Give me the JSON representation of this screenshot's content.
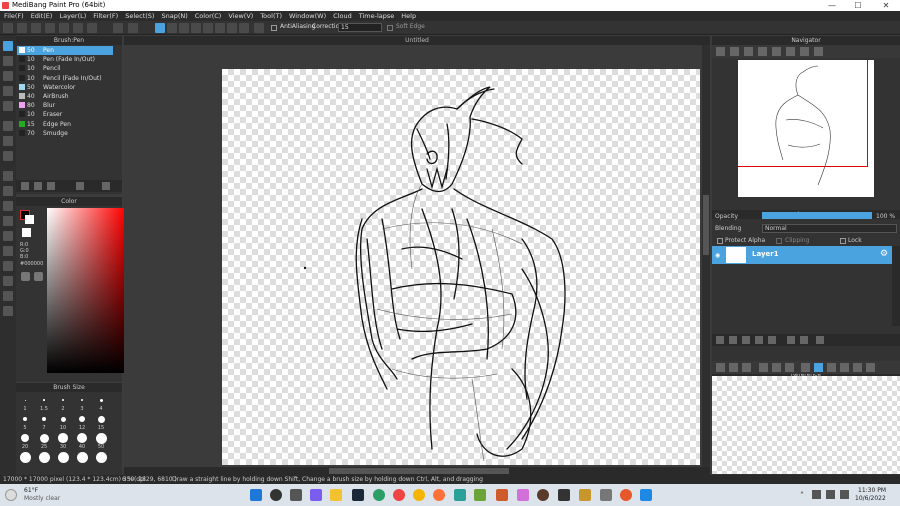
{
  "window": {
    "title": "MediBang Paint Pro (64bit)",
    "min": "—",
    "max": "☐",
    "close": "✕"
  },
  "menu": [
    "File(F)",
    "Edit(E)",
    "Layer(L)",
    "Filter(F)",
    "Select(S)",
    "Snap(N)",
    "Color(C)",
    "View(V)",
    "Tool(T)",
    "Window(W)",
    "Cloud",
    "Time-lapse",
    "Help"
  ],
  "toolbar": {
    "antialiasing": "AntiAliasing",
    "correction_label": "Correction",
    "correction_value": "15",
    "soft_edge": "Soft Edge"
  },
  "brush_panel": {
    "title": "Brush:Pen",
    "items": [
      {
        "size": "50",
        "name": "Pen",
        "color": "#ffffff",
        "selected": true
      },
      {
        "size": "10",
        "name": "Pen (Fade In/Out)",
        "color": "#222222"
      },
      {
        "size": "10",
        "name": "Pencil",
        "color": "#222222"
      },
      {
        "size": "10",
        "name": "Pencil (Fade In/Out)",
        "color": "#222222"
      },
      {
        "size": "50",
        "name": "Watercolor",
        "color": "#9fd8f0"
      },
      {
        "size": "40",
        "name": "AirBrush",
        "color": "#bbbbbb"
      },
      {
        "size": "80",
        "name": "Blur",
        "color": "#f0a0f0"
      },
      {
        "size": "10",
        "name": "Eraser",
        "color": "#222222"
      },
      {
        "size": "15",
        "name": "Edge Pen",
        "color": "#22aa22"
      },
      {
        "size": "70",
        "name": "Smudge",
        "color": "#222222"
      }
    ]
  },
  "color_panel": {
    "title": "Color",
    "r": "R:0",
    "g": "G:0",
    "b": "B:0",
    "hex": "#000000"
  },
  "brush_size_panel": {
    "title": "Brush Size",
    "labels": [
      "1",
      "1.5",
      "2",
      "3",
      "4",
      "5",
      "7",
      "10",
      "12",
      "15",
      "20",
      "25",
      "30",
      "40",
      "50"
    ]
  },
  "document": {
    "tab": "Untitled"
  },
  "status": {
    "size": "17000 * 17000 pixel  (123.4 * 123.4cm)  350 dpi",
    "zoom": "6 %",
    "coords": "( 2829, 6810 )",
    "hint": "Draw a straight line by holding down Shift, Change a brush size by holding down Ctrl, Alt, and dragging"
  },
  "navigator": {
    "title": "Navigator"
  },
  "layer_panel": {
    "title": "Layer",
    "opacity_label": "Opacity",
    "opacity_value": "100 %",
    "opacity": 1.0,
    "blending_label": "Blending",
    "blending_value": "Normal",
    "protect_alpha": "Protect Alpha",
    "clipping": "Clipping",
    "lock": "Lock",
    "layer_name": "Layer1"
  },
  "reference": {
    "title": "Reference"
  },
  "taskbar": {
    "temp": "61°F",
    "weather": "Mostly clear",
    "time": "11:30 PM",
    "date": "10/6/2022"
  }
}
